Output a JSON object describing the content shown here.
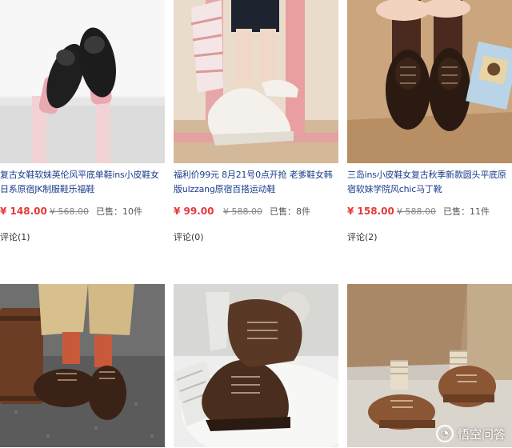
{
  "products": [
    {
      "title": "复古女鞋软妹英伦风平底单鞋ins小皮鞋女日系原宿JK制服鞋乐福鞋",
      "price": "¥ 148.00",
      "original_price": "¥ 568.00",
      "sold": "已售：10件",
      "comments": "评论(1)"
    },
    {
      "title": "福利价99元 8月21号0点开抢 老爹鞋女韩版ulzzang原宿百搭运动鞋",
      "price": "¥ 99.00",
      "original_price": "¥ 588.00",
      "sold": "已售：8件",
      "comments": "评论(0)"
    },
    {
      "title": "三岛ins小皮鞋女复古秋季新款圆头平底原宿软妹学院风chic马丁靴",
      "price": "¥ 158.00",
      "original_price": "¥ 588.00",
      "sold": "已售：11件",
      "comments": "评论(2)"
    },
    {},
    {},
    {}
  ],
  "watermark": {
    "text": "悟空问答",
    "logo_icon": "wukong-logo-icon"
  },
  "colors": {
    "price": "#e4393c",
    "title_link": "#1a3c8c",
    "muted": "#888888"
  }
}
